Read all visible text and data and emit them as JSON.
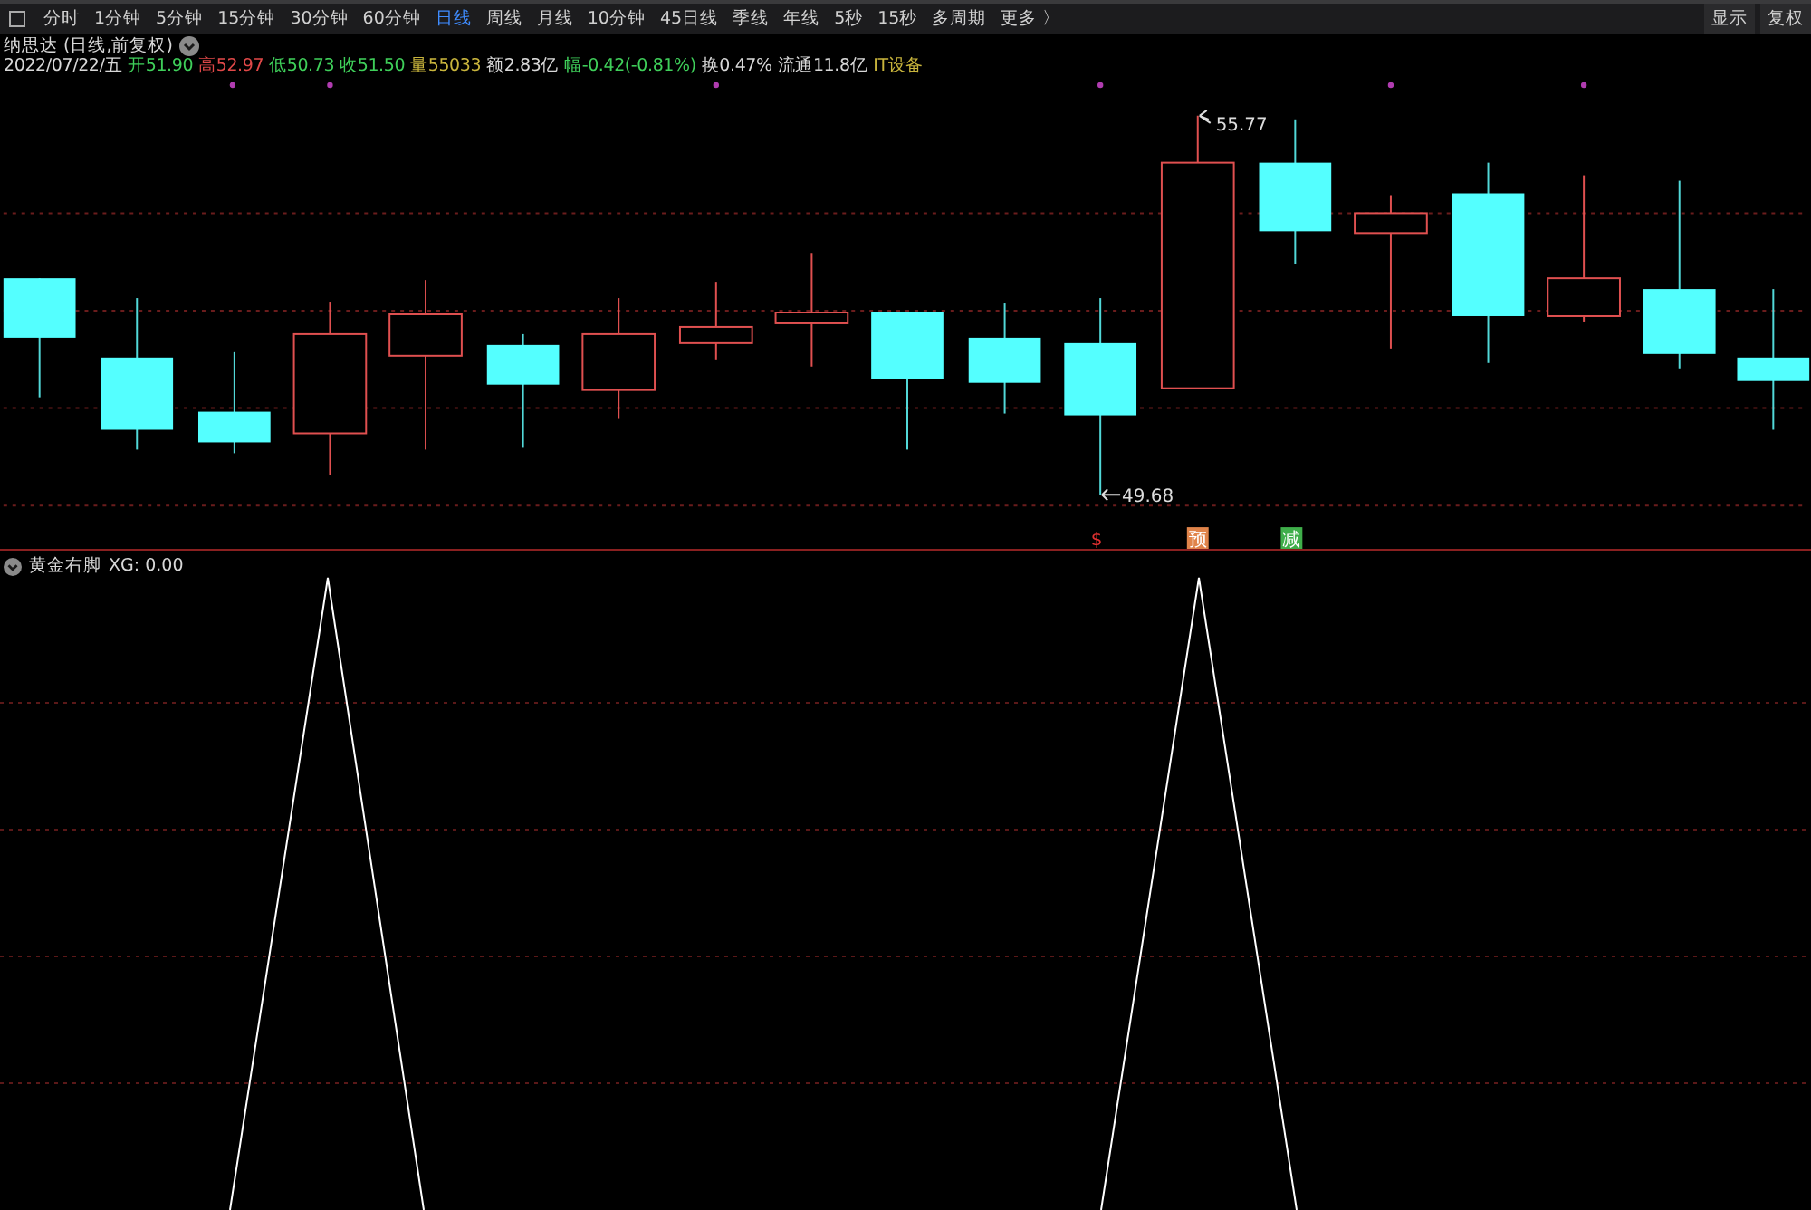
{
  "toolbar": {
    "periods": [
      {
        "label": "分时",
        "selected": false
      },
      {
        "label": "1分钟",
        "selected": false
      },
      {
        "label": "5分钟",
        "selected": false
      },
      {
        "label": "15分钟",
        "selected": false
      },
      {
        "label": "30分钟",
        "selected": false
      },
      {
        "label": "60分钟",
        "selected": false
      },
      {
        "label": "日线",
        "selected": true
      },
      {
        "label": "周线",
        "selected": false
      },
      {
        "label": "月线",
        "selected": false
      },
      {
        "label": "10分钟",
        "selected": false
      },
      {
        "label": "45日线",
        "selected": false
      },
      {
        "label": "季线",
        "selected": false
      },
      {
        "label": "年线",
        "selected": false
      },
      {
        "label": "5秒",
        "selected": false
      },
      {
        "label": "15秒",
        "selected": false
      },
      {
        "label": "多周期",
        "selected": false
      }
    ],
    "more": "更多 〉",
    "right_buttons": [
      "显示",
      "复权"
    ]
  },
  "stock": {
    "title": "纳思达 (日线,前复权)",
    "quote": [
      {
        "text": "2022/07/22/五",
        "color": "#d8d8d8"
      },
      {
        "text": "开51.90",
        "color": "#3fcf5a"
      },
      {
        "text": "高52.97",
        "color": "#e04848"
      },
      {
        "text": "低50.73",
        "color": "#3fcf5a"
      },
      {
        "text": "收51.50",
        "color": "#3fcf5a"
      },
      {
        "text": "量55033",
        "color": "#c8b43c"
      },
      {
        "text": "额2.83亿",
        "color": "#d8d8d8"
      },
      {
        "text": "幅-0.42(-0.81%)",
        "color": "#3fcf5a"
      },
      {
        "text": "换0.47%",
        "color": "#d8d8d8"
      },
      {
        "text": "流通11.8亿",
        "color": "#d8d8d8"
      },
      {
        "text": "IT设备",
        "color": "#c8b43c"
      }
    ]
  },
  "price_chart": {
    "high_label": "55.77",
    "low_label": "49.68",
    "signals": [
      {
        "text": "$",
        "kind": "plain",
        "color": "#e03030"
      },
      {
        "text": "预",
        "kind": "boxed",
        "color": "#e0844a"
      },
      {
        "text": "减",
        "kind": "boxed",
        "color": "#3fae4a"
      }
    ]
  },
  "indicator": {
    "title": "黄金右脚",
    "reading": "XG: 0.00"
  }
}
